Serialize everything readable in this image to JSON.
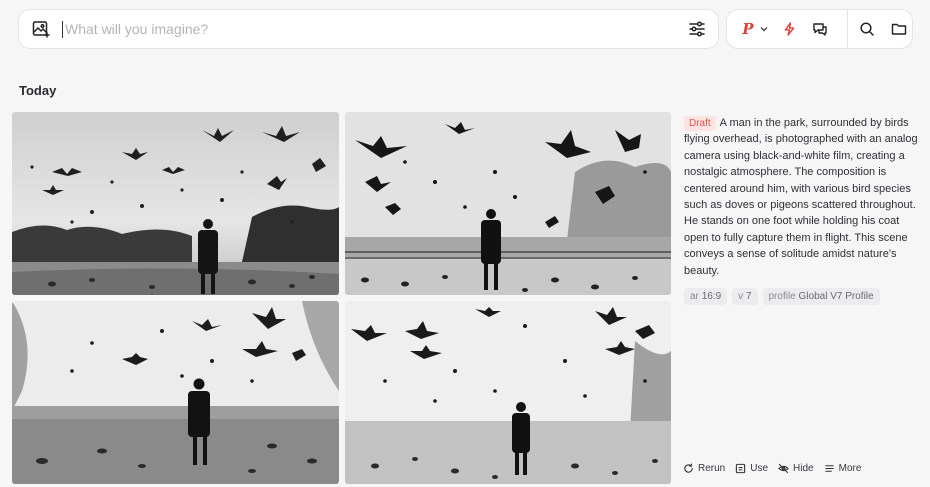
{
  "prompt": {
    "placeholder": "What will you imagine?"
  },
  "tools": {
    "mode_letter": "P"
  },
  "section": {
    "title": "Today"
  },
  "job": {
    "status": "Draft",
    "description": "A man in the park, surrounded by birds flying overhead, is photographed with an analog camera using black-and-white film, creating a nostalgic atmosphere. The composition is centered around him, with various bird species such as doves or pigeons scattered throughout. He stands on one foot while holding his coat open to fully capture them in flight. This scene conveys a sense of solitude amidst nature's beauty.",
    "tags": [
      {
        "key": "ar",
        "value": "16:9"
      },
      {
        "key": "v",
        "value": "7"
      },
      {
        "key": "profile",
        "value": "Global V7 Profile"
      }
    ],
    "actions": [
      "Rerun",
      "Use",
      "Hide",
      "More"
    ]
  },
  "colors": {
    "accent": "#e0413a",
    "draft_bg": "#fde4e1",
    "draft_text": "#d9534f"
  },
  "icons": [
    "image-add-icon",
    "sliders-icon",
    "chevron-down-icon",
    "bolt-icon",
    "chat-icon",
    "search-icon",
    "folder-icon",
    "rerun-icon",
    "use-icon",
    "hide-icon",
    "more-icon"
  ]
}
